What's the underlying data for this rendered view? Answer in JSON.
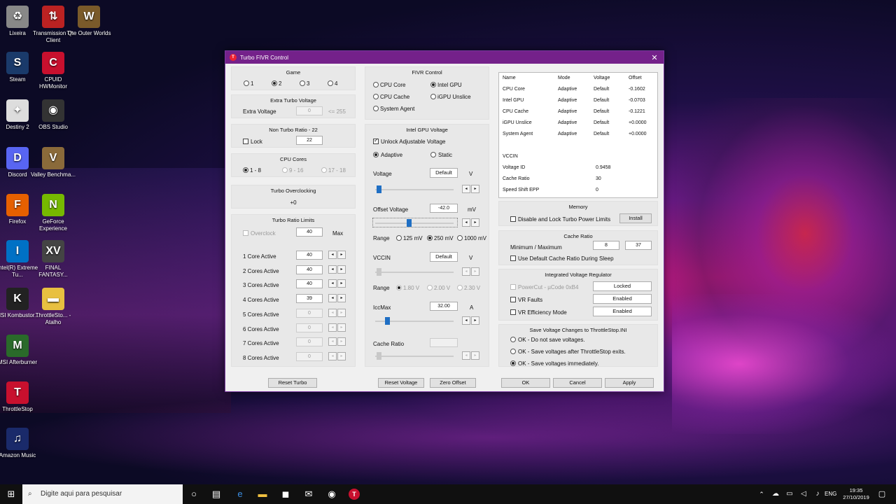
{
  "desktop": {
    "icons": [
      {
        "label": "Lixeira",
        "icon": "recycle-bin-icon"
      },
      {
        "label": "Transmission Qt Client",
        "icon": "transmission-icon"
      },
      {
        "label": "The Outer Worlds",
        "icon": "game-icon"
      },
      {
        "label": "Steam",
        "icon": "steam-icon"
      },
      {
        "label": "CPUID HWMonitor",
        "icon": "hwmonitor-icon"
      },
      {
        "label": "Destiny 2",
        "icon": "destiny-icon"
      },
      {
        "label": "OBS Studio",
        "icon": "obs-icon"
      },
      {
        "label": "Discord",
        "icon": "discord-icon"
      },
      {
        "label": "Valley Benchma...",
        "icon": "valley-icon"
      },
      {
        "label": "Firefox",
        "icon": "firefox-icon"
      },
      {
        "label": "GeForce Experience",
        "icon": "nvidia-icon"
      },
      {
        "label": "Intel(R) Extreme Tu...",
        "icon": "intel-icon"
      },
      {
        "label": "FINAL FANTASY...",
        "icon": "ff-icon"
      },
      {
        "label": "MSI Kombustor...",
        "icon": "kombustor-icon"
      },
      {
        "label": "ThrottleSto... - Atalho",
        "icon": "folder-icon"
      },
      {
        "label": "MSI Afterburner",
        "icon": "afterburner-icon"
      },
      {
        "label": "ThrottleStop",
        "icon": "throttlestop-icon"
      },
      {
        "label": "Amazon Music",
        "icon": "amazon-music-icon"
      }
    ]
  },
  "window": {
    "title": "Turbo FIVR Control",
    "game": {
      "title": "Game",
      "options": [
        "1",
        "2",
        "3",
        "4"
      ],
      "selected": "2"
    },
    "extra_turbo": {
      "title": "Extra Turbo Voltage",
      "label": "Extra Voltage",
      "value": "0",
      "hint": "<= 255"
    },
    "non_turbo": {
      "title": "Non Turbo Ratio - 22",
      "lock_label": "Lock",
      "value": "22"
    },
    "cpu_cores": {
      "title": "CPU Cores",
      "options": [
        "1 - 8",
        "9 - 16",
        "17 - 18"
      ]
    },
    "turbo_oc": {
      "title": "Turbo Overclocking",
      "value": "+0"
    },
    "turbo_limits": {
      "title": "Turbo Ratio Limits",
      "overclock_label": "Overclock",
      "overclock_value": "40",
      "max_label": "Max",
      "rows": [
        {
          "label": "1 Core Active",
          "value": "40"
        },
        {
          "label": "2 Cores Active",
          "value": "40"
        },
        {
          "label": "3 Cores Active",
          "value": "40"
        },
        {
          "label": "4 Cores Active",
          "value": "39"
        },
        {
          "label": "5 Cores Active",
          "value": "0"
        },
        {
          "label": "6 Cores Active",
          "value": "0"
        },
        {
          "label": "7 Cores Active",
          "value": "0"
        },
        {
          "label": "8 Cores Active",
          "value": "0"
        }
      ]
    },
    "fivr": {
      "title": "FIVR Control",
      "options": [
        "CPU Core",
        "Intel GPU",
        "CPU Cache",
        "iGPU Unslice",
        "System Agent"
      ],
      "selected": "Intel GPU"
    },
    "gpu_voltage": {
      "title": "Intel GPU Voltage",
      "unlock_label": "Unlock Adjustable Voltage",
      "adaptive_label": "Adaptive",
      "static_label": "Static",
      "voltage_label": "Voltage",
      "voltage_value": "Default",
      "voltage_unit": "V",
      "offset_label": "Offset Voltage",
      "offset_value": "-42.0",
      "offset_unit": "mV",
      "range_label": "Range",
      "range_options": [
        "125 mV",
        "250 mV",
        "1000 mV"
      ],
      "range_selected": "250 mV",
      "vccin_label": "VCCIN",
      "vccin_value": "Default",
      "vccin_unit": "V",
      "range2_options": [
        "1.80 V",
        "2.00 V",
        "2.30 V"
      ],
      "iccmax_label": "IccMax",
      "iccmax_value": "32.00",
      "iccmax_unit": "A",
      "cache_ratio_label": "Cache Ratio",
      "cache_ratio_value": ""
    },
    "table": {
      "headers": [
        "Name",
        "Mode",
        "Voltage",
        "Offset"
      ],
      "rows": [
        [
          "CPU Core",
          "Adaptive",
          "Default",
          "-0.1602"
        ],
        [
          "Intel GPU",
          "Adaptive",
          "Default",
          "-0.0703"
        ],
        [
          "CPU Cache",
          "Adaptive",
          "Default",
          "-0.1221"
        ],
        [
          "iGPU Unslice",
          "Adaptive",
          "Default",
          "+0.0000"
        ],
        [
          "System Agent",
          "Adaptive",
          "Default",
          "+0.0000"
        ]
      ],
      "extra": [
        {
          "label": "VCCIN",
          "value": ""
        },
        {
          "label": "Voltage ID",
          "value": "0.9458"
        },
        {
          "label": "Cache Ratio",
          "value": "30"
        },
        {
          "label": "Speed Shift EPP",
          "value": "0"
        }
      ]
    },
    "memory": {
      "title": "Memory",
      "label": "Disable and Lock Turbo Power Limits",
      "button": "Install"
    },
    "cache_ratio": {
      "title": "Cache Ratio",
      "label": "Minimum / Maximum",
      "min": "8",
      "max": "37",
      "sleep_label": "Use Default Cache Ratio During Sleep"
    },
    "ivr": {
      "title": "Integrated Voltage Regulator",
      "rows": [
        {
          "label": "PowerCut  -  µCode 0xB4",
          "button": "Locked"
        },
        {
          "label": "VR Faults",
          "button": "Enabled"
        },
        {
          "label": "VR Efficiency Mode",
          "button": "Enabled"
        }
      ]
    },
    "save": {
      "title": "Save Voltage Changes to ThrottleStop.INI",
      "options": [
        "OK - Do not save voltages.",
        "OK - Save voltages after ThrottleStop exits.",
        "OK - Save voltages immediately."
      ],
      "selected": 2
    },
    "buttons": {
      "reset_turbo": "Reset Turbo",
      "reset_voltage": "Reset Voltage",
      "zero_offset": "Zero Offset",
      "ok": "OK",
      "cancel": "Cancel",
      "apply": "Apply"
    }
  },
  "taskbar": {
    "search_placeholder": "Digite aqui para pesquisar",
    "lang": "ENG",
    "time": "19:35",
    "date": "27/10/2019"
  }
}
